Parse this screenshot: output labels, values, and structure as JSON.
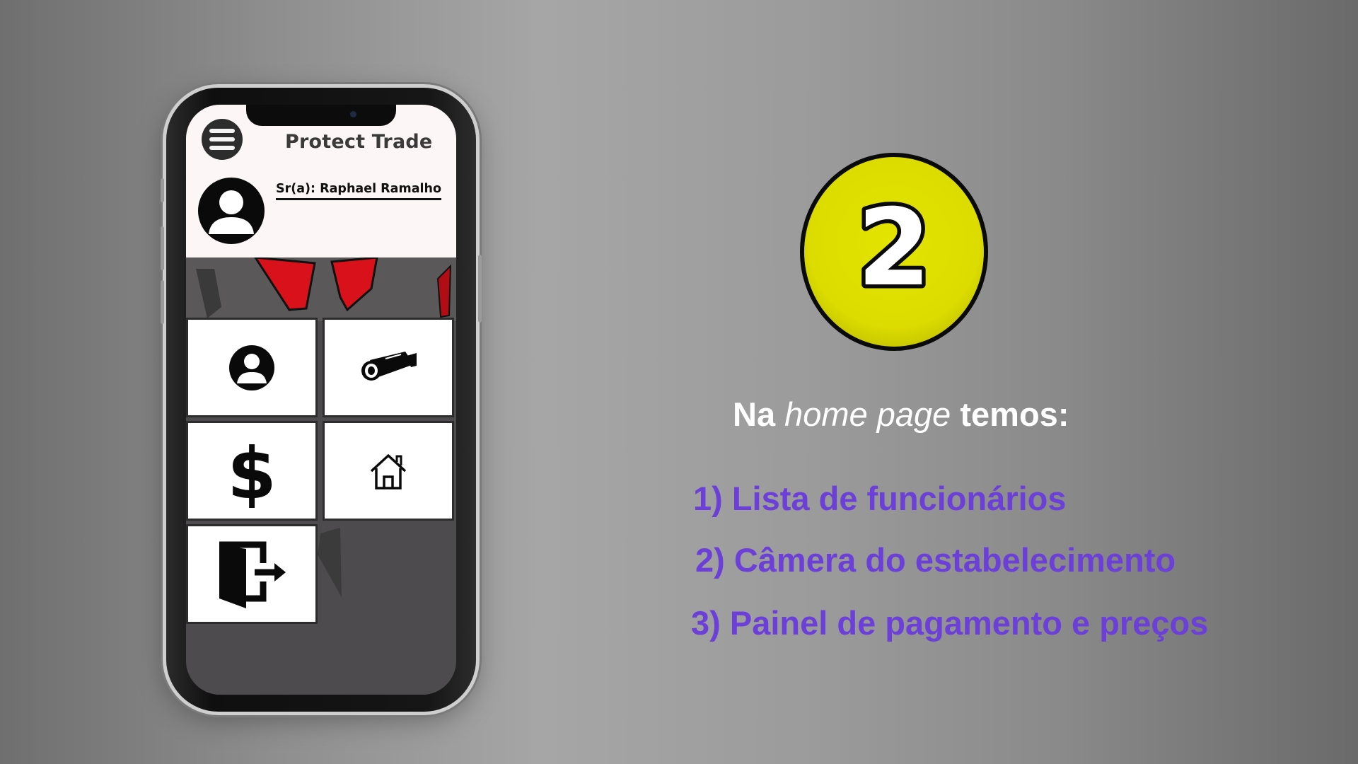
{
  "phone": {
    "app_title": "Protect Trade",
    "user_name": "Sr(a): Raphael Ramalho",
    "tiles": [
      {
        "icon": "user-icon"
      },
      {
        "icon": "security-camera-icon"
      },
      {
        "icon": "dollar-icon"
      },
      {
        "icon": "home-icon"
      },
      {
        "icon": "logout-icon"
      }
    ]
  },
  "slide": {
    "step_number": "2",
    "intro": {
      "part1": "Na ",
      "part2": "home page",
      "part3": " temos:"
    },
    "features": [
      "1) Lista de funcionários",
      "2) Câmera do estabelecimento",
      "3) Painel de pagamento e preços"
    ]
  },
  "colors": {
    "badge_yellow": "#dcdc00",
    "feature_purple": "#6c3fd8",
    "header_bg": "#fdf6f6",
    "wallpaper_red": "#d9111a"
  }
}
